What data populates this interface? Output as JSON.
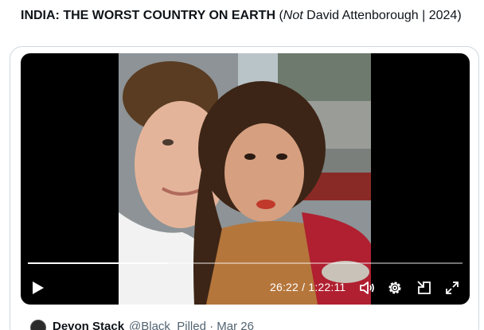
{
  "post": {
    "title_bold": "INDIA: THE WORST COUNTRY ON EARTH",
    "title_paren_open": " (",
    "title_italic": "Not",
    "title_rest": " David Attenborough | 2024)"
  },
  "video": {
    "time_current": "26:22",
    "time_separator": " / ",
    "time_total": "1:22:11",
    "progress_fraction": 0.32
  },
  "quote": {
    "name": "Devon Stack",
    "handle_and_date": "@Black_Pilled · Mar 26"
  },
  "icons": {
    "play": "play-icon",
    "volume": "volume-icon",
    "settings": "gear-icon",
    "pip": "picture-in-picture-icon",
    "fullscreen": "fullscreen-icon"
  }
}
